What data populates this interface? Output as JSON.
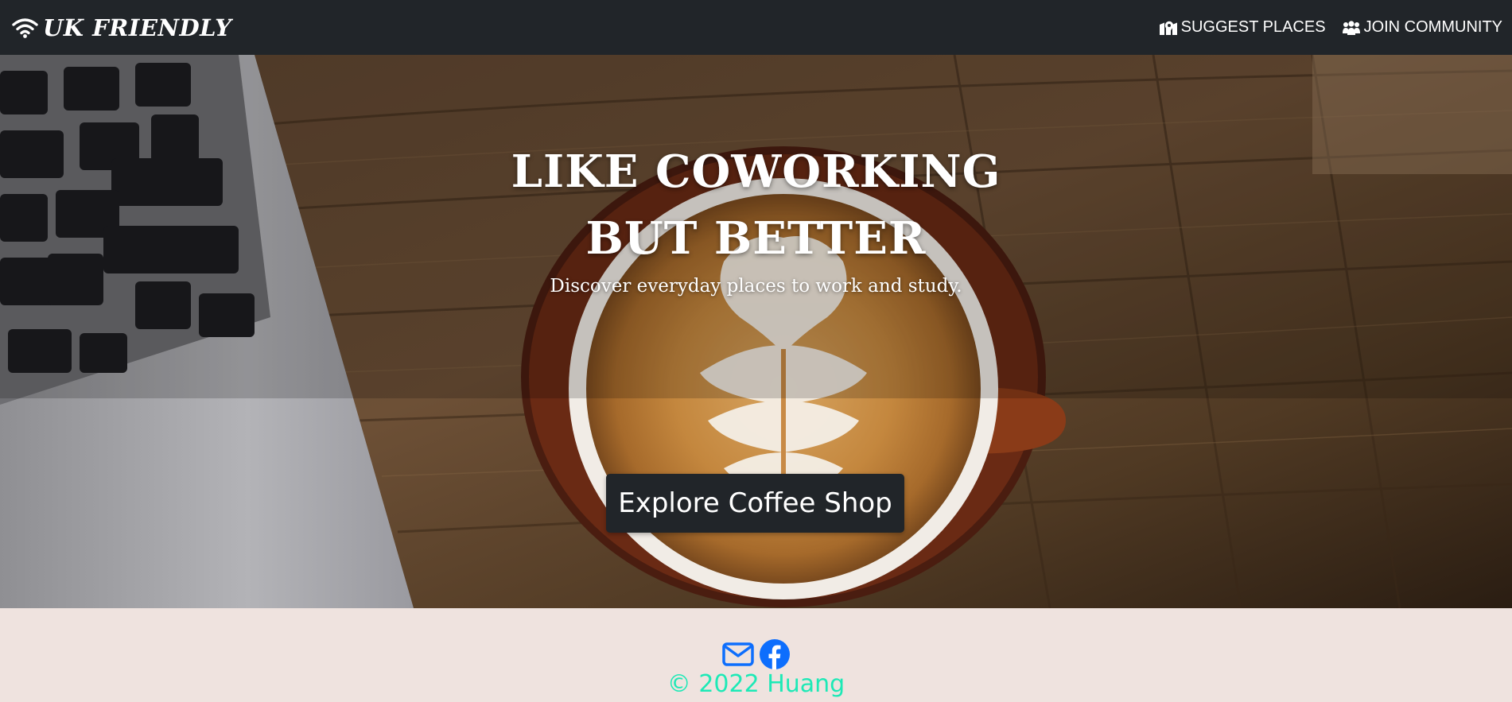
{
  "navbar": {
    "brand": "UK FRIENDLY",
    "brand_icon": "wifi-icon",
    "links": [
      {
        "label": "SUGGEST PLACES",
        "icon": "map-location-icon"
      },
      {
        "label": "JOIN COMMUNITY",
        "icon": "people-group-icon"
      }
    ]
  },
  "hero": {
    "title_line1": "LIKE COWORKING",
    "title_line2": "BUT BETTER",
    "subtitle": "Discover everyday places to work and study.",
    "cta_label": "Explore Coffee Shop",
    "background": "coffee-cup-and-laptop-on-wooden-table"
  },
  "footer": {
    "social_icons": [
      "envelope-icon",
      "facebook-icon"
    ],
    "copyright": "© 2022 Huang"
  },
  "colors": {
    "navbar_bg": "#212529",
    "button_bg": "#212529",
    "footer_bg": "#efe3df",
    "social_icon": "#0d6efd",
    "copyright": "#1de9b6"
  }
}
